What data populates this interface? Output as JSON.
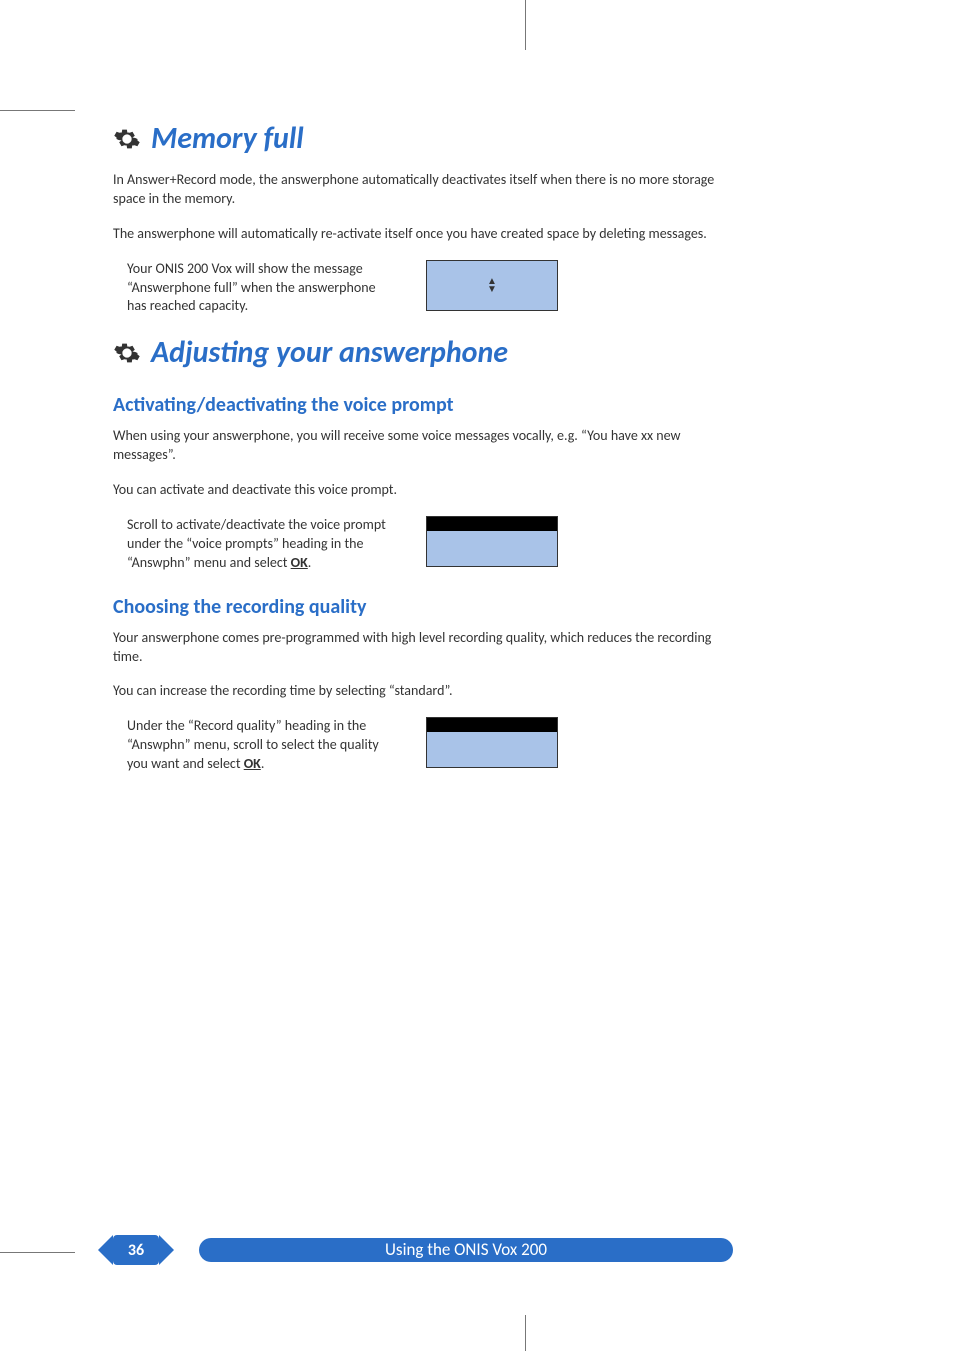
{
  "section1": {
    "title": "Memory full",
    "para1": "In Answer+Record mode, the answerphone automatically deactivates itself when there is no more storage space in the memory.",
    "para2": "The answerphone will automatically re-activate itself once you have created space by deleting messages.",
    "step1": "Your ONIS 200 Vox will show the message “Answerphone full” when the answerphone has reached capacity."
  },
  "section2": {
    "title": "Adjusting your answerphone",
    "sub1": {
      "heading": "Activating/deactivating the voice prompt",
      "para1": "When using your answerphone, you will receive some voice messages vocally, e.g. “You have xx new messages”.",
      "para2": "You can activate and deactivate this voice prompt.",
      "step_pre": "Scroll to activate/deactivate the voice prompt under the “voice prompts” heading in the “Answphn” menu and select ",
      "step_ok": "OK",
      "step_post": "."
    },
    "sub2": {
      "heading": "Choosing the recording quality",
      "para1": "Your answerphone comes pre-programmed with high level recording quality, which reduces the recording time.",
      "para2": "You can increase the recording time by selecting “standard”.",
      "step_pre": "Under the “Record quality” heading in the “Answphn” menu, scroll to select the quality you want and select ",
      "step_ok": "OK",
      "step_post": "."
    }
  },
  "footer": {
    "page_number": "36",
    "chapter": "Using the ONIS Vox 200"
  }
}
